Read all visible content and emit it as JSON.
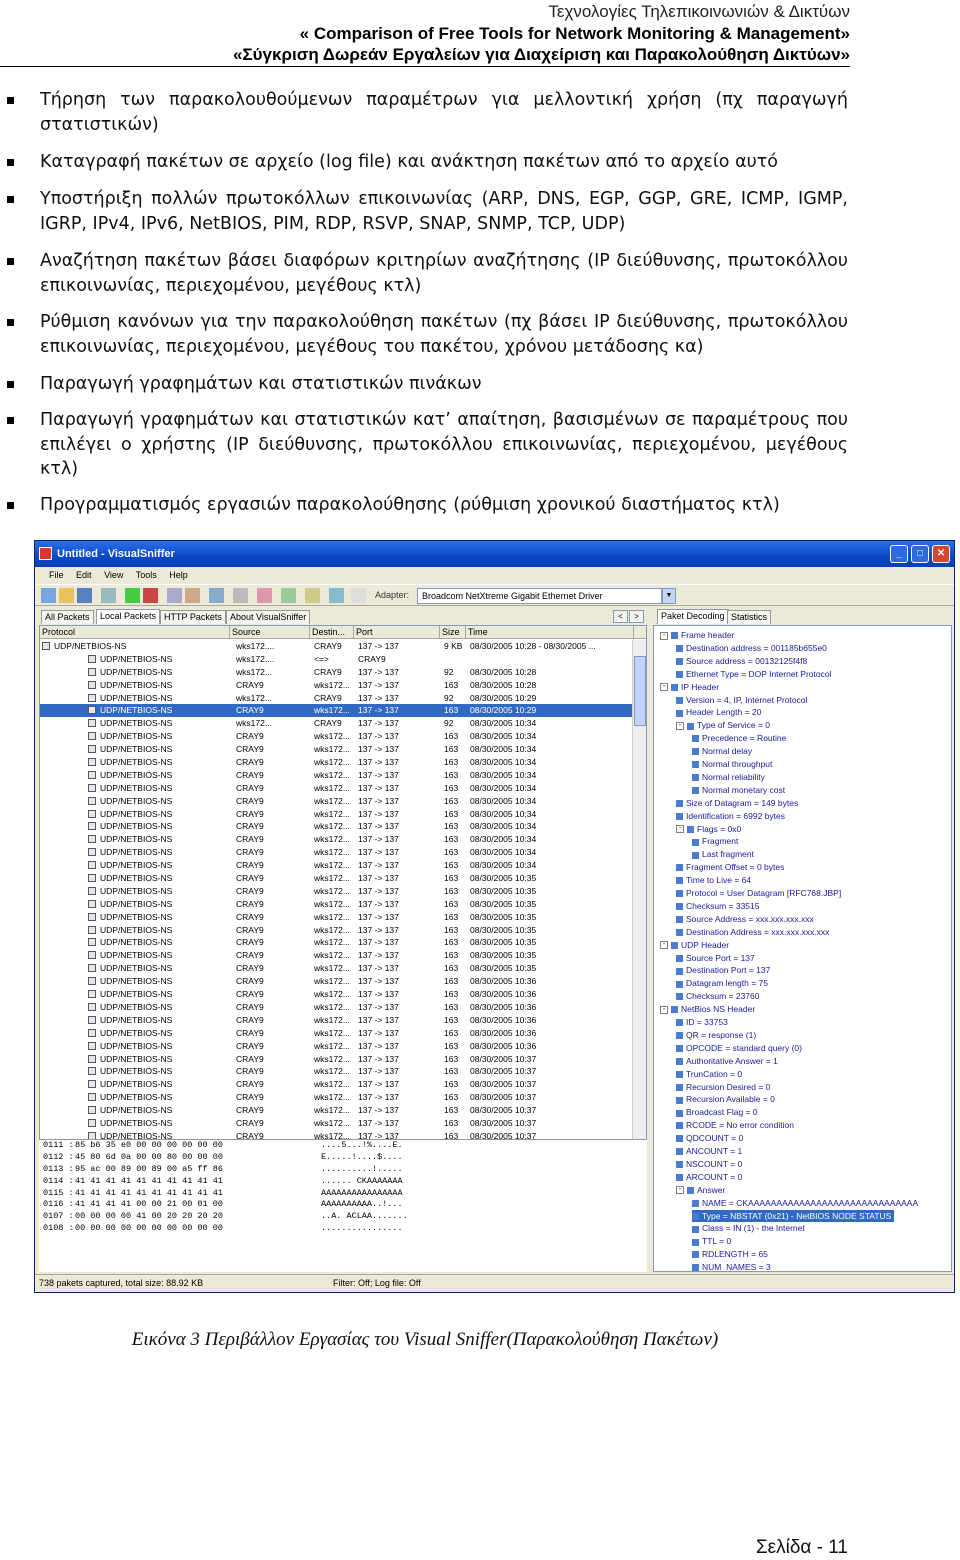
{
  "header": {
    "line1": "Τεχνολογίες Τηλεπικοινωνιών & Δικτύων",
    "line2": "« Comparison of Free Tools for Network Monitoring & Management»",
    "line3": "«Σύγκριση Δωρεάν Εργαλείων για Διαχείριση και Παρακολούθηση Δικτύων»"
  },
  "bullets": [
    "Τήρηση των παρακολουθούμενων παραμέτρων για μελλοντική χρήση (πχ παραγωγή στατιστικών)",
    "Καταγραφή πακέτων σε αρχείο (log file) και ανάκτηση πακέτων από το αρχείο αυτό",
    "Υποστήριξη πολλών πρωτοκόλλων επικοινωνίας (ARP, DNS, EGP, GGP, GRE, ICMP, IGMP, IGRP, IPv4, IPv6, NetBIOS, PIM, RDP, RSVP, SNAP, SNMP, TCP, UDP)",
    "Αναζήτηση πακέτων βάσει διαφόρων κριτηρίων αναζήτησης (IP διεύθυνσης, πρωτοκόλλου επικοινωνίας, περιεχομένου, μεγέθους κτλ)",
    "Ρύθμιση κανόνων για την παρακολούθηση πακέτων (πχ βάσει IP διεύθυνσης, πρωτοκόλλου επικοινωνίας, περιεχομένου, μεγέθους του πακέτου, χρόνου μετάδοσης κα)",
    "Παραγωγή γραφημάτων και στατιστικών πινάκων",
    "Παραγωγή γραφημάτων και στατιστικών κατ’ απαίτηση, βασισμένων σε παραμέτρους που επιλέγει ο χρήστης (IP διεύθυνσης, πρωτοκόλλου επικοινωνίας, περιεχομένου, μεγέθους κτλ)",
    "Προγραμματισμός εργασιών παρακολούθησης (ρύθμιση χρονικού διαστήματος κτλ)"
  ],
  "app": {
    "title": "Untitled - VisualSniffer",
    "menu": [
      "File",
      "Edit",
      "View",
      "Tools",
      "Help"
    ],
    "adapter_label": "Adapter:",
    "adapter_value": "Broadcom NetXtreme Gigabit Ethernet Driver",
    "left_tabs": [
      "All Packets",
      "Local Packets",
      "HTTP Packets",
      "About VisualSniffer"
    ],
    "right_tabs": [
      "Paket Decoding",
      "Statistics"
    ],
    "columns": [
      "Protocol",
      "Source",
      "Destin...",
      "Port",
      "Size",
      "Time"
    ],
    "packets": [
      {
        "p": "UDP/NETBIOS-NS",
        "s": "wks172....",
        "d": "CRAY9",
        "port": "137 -> 137",
        "size": "9 KB",
        "t": "08/30/2005 10:28 - 08/30/2005 ..."
      },
      {
        "p": "UDP/NETBIOS-NS",
        "s": "wks172....",
        "d": "<=>",
        "port": "CRAY9",
        "size": "",
        "t": "",
        "group": true
      },
      {
        "p": "UDP/NETBIOS-NS",
        "s": "wks172...",
        "d": "CRAY9",
        "port": "137 -> 137",
        "size": "92",
        "t": "08/30/2005 10:28"
      },
      {
        "p": "UDP/NETBIOS-NS",
        "s": "CRAY9",
        "d": "wks172...",
        "port": "137 -> 137",
        "size": "163",
        "t": "08/30/2005 10:28"
      },
      {
        "p": "UDP/NETBIOS-NS",
        "s": "wks172...",
        "d": "CRAY9",
        "port": "137 -> 137",
        "size": "92",
        "t": "08/30/2005 10:29"
      },
      {
        "p": "UDP/NETBIOS-NS",
        "s": "CRAY9",
        "d": "wks172...",
        "port": "137 -> 137",
        "size": "163",
        "t": "08/30/2005 10:29",
        "sel": true
      },
      {
        "p": "UDP/NETBIOS-NS",
        "s": "wks172...",
        "d": "CRAY9",
        "port": "137 -> 137",
        "size": "92",
        "t": "08/30/2005 10:34"
      },
      {
        "p": "UDP/NETBIOS-NS",
        "s": "CRAY9",
        "d": "wks172...",
        "port": "137 -> 137",
        "size": "163",
        "t": "08/30/2005 10:34"
      },
      {
        "p": "UDP/NETBIOS-NS",
        "s": "CRAY9",
        "d": "wks172...",
        "port": "137 -> 137",
        "size": "163",
        "t": "08/30/2005 10:34"
      },
      {
        "p": "UDP/NETBIOS-NS",
        "s": "CRAY9",
        "d": "wks172...",
        "port": "137 -> 137",
        "size": "163",
        "t": "08/30/2005 10:34"
      },
      {
        "p": "UDP/NETBIOS-NS",
        "s": "CRAY9",
        "d": "wks172...",
        "port": "137 -> 137",
        "size": "163",
        "t": "08/30/2005 10:34"
      },
      {
        "p": "UDP/NETBIOS-NS",
        "s": "CRAY9",
        "d": "wks172...",
        "port": "137 -> 137",
        "size": "163",
        "t": "08/30/2005 10:34"
      },
      {
        "p": "UDP/NETBIOS-NS",
        "s": "CRAY9",
        "d": "wks172...",
        "port": "137 -> 137",
        "size": "163",
        "t": "08/30/2005 10:34"
      },
      {
        "p": "UDP/NETBIOS-NS",
        "s": "CRAY9",
        "d": "wks172...",
        "port": "137 -> 137",
        "size": "163",
        "t": "08/30/2005 10:34"
      },
      {
        "p": "UDP/NETBIOS-NS",
        "s": "CRAY9",
        "d": "wks172...",
        "port": "137 -> 137",
        "size": "163",
        "t": "08/30/2005 10:34"
      },
      {
        "p": "UDP/NETBIOS-NS",
        "s": "CRAY9",
        "d": "wks172...",
        "port": "137 -> 137",
        "size": "163",
        "t": "08/30/2005 10:34"
      },
      {
        "p": "UDP/NETBIOS-NS",
        "s": "CRAY9",
        "d": "wks172...",
        "port": "137 -> 137",
        "size": "163",
        "t": "08/30/2005 10:34"
      },
      {
        "p": "UDP/NETBIOS-NS",
        "s": "CRAY9",
        "d": "wks172...",
        "port": "137 -> 137",
        "size": "163",
        "t": "08/30/2005 10:34"
      },
      {
        "p": "UDP/NETBIOS-NS",
        "s": "CRAY9",
        "d": "wks172...",
        "port": "137 -> 137",
        "size": "163",
        "t": "08/30/2005 10:35"
      },
      {
        "p": "UDP/NETBIOS-NS",
        "s": "CRAY9",
        "d": "wks172...",
        "port": "137 -> 137",
        "size": "163",
        "t": "08/30/2005 10:35"
      },
      {
        "p": "UDP/NETBIOS-NS",
        "s": "CRAY9",
        "d": "wks172...",
        "port": "137 -> 137",
        "size": "163",
        "t": "08/30/2005 10:35"
      },
      {
        "p": "UDP/NETBIOS-NS",
        "s": "CRAY9",
        "d": "wks172...",
        "port": "137 -> 137",
        "size": "163",
        "t": "08/30/2005 10:35"
      },
      {
        "p": "UDP/NETBIOS-NS",
        "s": "CRAY9",
        "d": "wks172...",
        "port": "137 -> 137",
        "size": "163",
        "t": "08/30/2005 10:35"
      },
      {
        "p": "UDP/NETBIOS-NS",
        "s": "CRAY9",
        "d": "wks172...",
        "port": "137 -> 137",
        "size": "163",
        "t": "08/30/2005 10:35"
      },
      {
        "p": "UDP/NETBIOS-NS",
        "s": "CRAY9",
        "d": "wks172...",
        "port": "137 -> 137",
        "size": "163",
        "t": "08/30/2005 10:35"
      },
      {
        "p": "UDP/NETBIOS-NS",
        "s": "CRAY9",
        "d": "wks172...",
        "port": "137 -> 137",
        "size": "163",
        "t": "08/30/2005 10:35"
      },
      {
        "p": "UDP/NETBIOS-NS",
        "s": "CRAY9",
        "d": "wks172...",
        "port": "137 -> 137",
        "size": "163",
        "t": "08/30/2005 10:36"
      },
      {
        "p": "UDP/NETBIOS-NS",
        "s": "CRAY9",
        "d": "wks172...",
        "port": "137 -> 137",
        "size": "163",
        "t": "08/30/2005 10:36"
      },
      {
        "p": "UDP/NETBIOS-NS",
        "s": "CRAY9",
        "d": "wks172...",
        "port": "137 -> 137",
        "size": "163",
        "t": "08/30/2005 10:36"
      },
      {
        "p": "UDP/NETBIOS-NS",
        "s": "CRAY9",
        "d": "wks172...",
        "port": "137 -> 137",
        "size": "163",
        "t": "08/30/2005 10:36"
      },
      {
        "p": "UDP/NETBIOS-NS",
        "s": "CRAY9",
        "d": "wks172...",
        "port": "137 -> 137",
        "size": "163",
        "t": "08/30/2005 10:36"
      },
      {
        "p": "UDP/NETBIOS-NS",
        "s": "CRAY9",
        "d": "wks172...",
        "port": "137 -> 137",
        "size": "163",
        "t": "08/30/2005 10:36"
      },
      {
        "p": "UDP/NETBIOS-NS",
        "s": "CRAY9",
        "d": "wks172...",
        "port": "137 -> 137",
        "size": "163",
        "t": "08/30/2005 10:37"
      },
      {
        "p": "UDP/NETBIOS-NS",
        "s": "CRAY9",
        "d": "wks172...",
        "port": "137 -> 137",
        "size": "163",
        "t": "08/30/2005 10:37"
      },
      {
        "p": "UDP/NETBIOS-NS",
        "s": "CRAY9",
        "d": "wks172...",
        "port": "137 -> 137",
        "size": "163",
        "t": "08/30/2005 10:37"
      },
      {
        "p": "UDP/NETBIOS-NS",
        "s": "CRAY9",
        "d": "wks172...",
        "port": "137 -> 137",
        "size": "163",
        "t": "08/30/2005 10:37"
      },
      {
        "p": "UDP/NETBIOS-NS",
        "s": "CRAY9",
        "d": "wks172...",
        "port": "137 -> 137",
        "size": "163",
        "t": "08/30/2005 10:37"
      },
      {
        "p": "UDP/NETBIOS-NS",
        "s": "CRAY9",
        "d": "wks172...",
        "port": "137 -> 137",
        "size": "163",
        "t": "08/30/2005 10:37"
      },
      {
        "p": "UDP/NETBIOS-NS",
        "s": "CRAY9",
        "d": "wks172...",
        "port": "137 -> 137",
        "size": "163",
        "t": "08/30/2005 10:37"
      },
      {
        "p": "UDP/NETBIOS-NS",
        "s": "CRAY9",
        "d": "wks172...",
        "port": "137 -> 137",
        "size": "163",
        "t": "08/30/2005 10:37"
      },
      {
        "p": "UDP/NETBIOS-NS",
        "s": "CRAY9",
        "d": "wks172...",
        "port": "137 -> 137",
        "size": "163",
        "t": "08/30/2005 10:37"
      },
      {
        "p": "UDP/NETBIOS-NS",
        "s": "CRAY9",
        "d": "wks172...",
        "port": "137 -> 137",
        "size": "163",
        "t": "08/30/2005 10:37"
      },
      {
        "p": "UDP/NETBIOS-NS",
        "s": "CRAY9",
        "d": "wks172...",
        "port": "137 -> 137",
        "size": "163",
        "t": "08/30/2005 10:37"
      },
      {
        "p": "UDP/NETBIOS-NS",
        "s": "CRAY9",
        "d": "wks172...",
        "port": "137 -> 137",
        "size": "163",
        "t": "08/30/2005 10:37"
      }
    ],
    "hex": [
      {
        "off": "0111 :",
        "bytes": "85 b6 35 e0 00 00 00 00 00 00",
        "ascii": "....5...!%....E."
      },
      {
        "off": "0112 :",
        "bytes": "45 80 6d 0a 00 00 80 00 00 00",
        "ascii": "E.....!....$...."
      },
      {
        "off": "0113 :",
        "bytes": "95 ac 00 89 00 89 00 a5 ff 86",
        "ascii": "..........!....."
      },
      {
        "off": "0114 :",
        "bytes": "41 41 41 41 41 41 41 41 41 41",
        "ascii": "...... CKAAAAAAA"
      },
      {
        "off": "0115 :",
        "bytes": "41 41 41 41 41 41 41 41 41 41",
        "ascii": "AAAAAAAAAAAAAAAA"
      },
      {
        "off": "0116 :",
        "bytes": "41 41 41 41 00 00 21 00 01 00",
        "ascii": "AAAAAAAAAA..!..."
      },
      {
        "off": "0107 :",
        "bytes": "00 00 00 00 41 00 20 20 20 20",
        "ascii": "..A. ACLAA......."
      },
      {
        "off": "0108 :",
        "bytes": "00 00 00 00 00 00 00 00 00 00",
        "ascii": "................"
      }
    ],
    "tree": [
      {
        "d": 0,
        "t": "Frame header",
        "tog": "-"
      },
      {
        "d": 1,
        "t": "Destination address = 001185b655e0"
      },
      {
        "d": 1,
        "t": "Source address = 00132125f4f8"
      },
      {
        "d": 1,
        "t": "Ethernet Type = DOP Internet Protocol"
      },
      {
        "d": 0,
        "t": "IP Header",
        "tog": "-"
      },
      {
        "d": 1,
        "t": "Version = 4, IP, Internet Protocol"
      },
      {
        "d": 1,
        "t": "Header Length = 20"
      },
      {
        "d": 1,
        "t": "Type of Service = 0",
        "tog": "-"
      },
      {
        "d": 2,
        "t": "Precedence = Routine"
      },
      {
        "d": 2,
        "t": "Normal delay"
      },
      {
        "d": 2,
        "t": "Normal throughput"
      },
      {
        "d": 2,
        "t": "Normal reliability"
      },
      {
        "d": 2,
        "t": "Normal monetary cost"
      },
      {
        "d": 1,
        "t": "Size of Datagram = 149 bytes"
      },
      {
        "d": 1,
        "t": "Identification = 6992 bytes"
      },
      {
        "d": 1,
        "t": "Flags = 0x0",
        "tog": "-"
      },
      {
        "d": 2,
        "t": "Fragment"
      },
      {
        "d": 2,
        "t": "Last fragment"
      },
      {
        "d": 1,
        "t": "Fragment Offset = 0 bytes"
      },
      {
        "d": 1,
        "t": "Time to Live = 64"
      },
      {
        "d": 1,
        "t": "Protocol = User Datagram [RFC768.JBP]"
      },
      {
        "d": 1,
        "t": "Checksum = 33515"
      },
      {
        "d": 1,
        "t": "Source Address = xxx.xxx.xxx.xxx"
      },
      {
        "d": 1,
        "t": "Destination Address = xxx.xxx.xxx.xxx"
      },
      {
        "d": 0,
        "t": "UDP Header",
        "tog": "-"
      },
      {
        "d": 1,
        "t": "Source Port = 137"
      },
      {
        "d": 1,
        "t": "Destination Port = 137"
      },
      {
        "d": 1,
        "t": "Datagram length = 75"
      },
      {
        "d": 1,
        "t": "Checksum = 23760"
      },
      {
        "d": 0,
        "t": "NetBios NS Header",
        "tog": "-"
      },
      {
        "d": 1,
        "t": "ID = 33753"
      },
      {
        "d": 1,
        "t": "QR = response (1)"
      },
      {
        "d": 1,
        "t": "OPCODE = standard query (0)"
      },
      {
        "d": 1,
        "t": "Authoritative Answer = 1"
      },
      {
        "d": 1,
        "t": "TrunCation = 0"
      },
      {
        "d": 1,
        "t": "Recursion Desired = 0"
      },
      {
        "d": 1,
        "t": "Recursion Available = 0"
      },
      {
        "d": 1,
        "t": "Broadcast Flag = 0"
      },
      {
        "d": 1,
        "t": "RCODE = No error condition"
      },
      {
        "d": 1,
        "t": "QDCOUNT = 0"
      },
      {
        "d": 1,
        "t": "ANCOUNT = 1"
      },
      {
        "d": 1,
        "t": "NSCOUNT = 0"
      },
      {
        "d": 1,
        "t": "ARCOUNT = 0"
      },
      {
        "d": 1,
        "t": "Answer",
        "tog": "-"
      },
      {
        "d": 2,
        "t": "NAME = CKAAAAAAAAAAAAAAAAAAAAAAAAAAAAAA"
      },
      {
        "d": 2,
        "t": "Type = NBSTAT (0x21) - NetBIOS NODE STATUS",
        "sel": true
      },
      {
        "d": 2,
        "t": "Class = IN (1) - the Internet"
      },
      {
        "d": 2,
        "t": "TTL = 0"
      },
      {
        "d": 2,
        "t": "RDLENGTH = 65"
      },
      {
        "d": 2,
        "t": "NUM_NAMES = 3"
      }
    ],
    "status_left": "738 pakets captured, total size: 88.92 KB",
    "status_right": "Filter: Off; Log file: Off"
  },
  "caption": "Εικόνα 3 Περιβάλλον Εργασίας του Visual Sniffer(Παρακολούθηση Πακέτων)",
  "page_number": "Σελίδα - 11"
}
